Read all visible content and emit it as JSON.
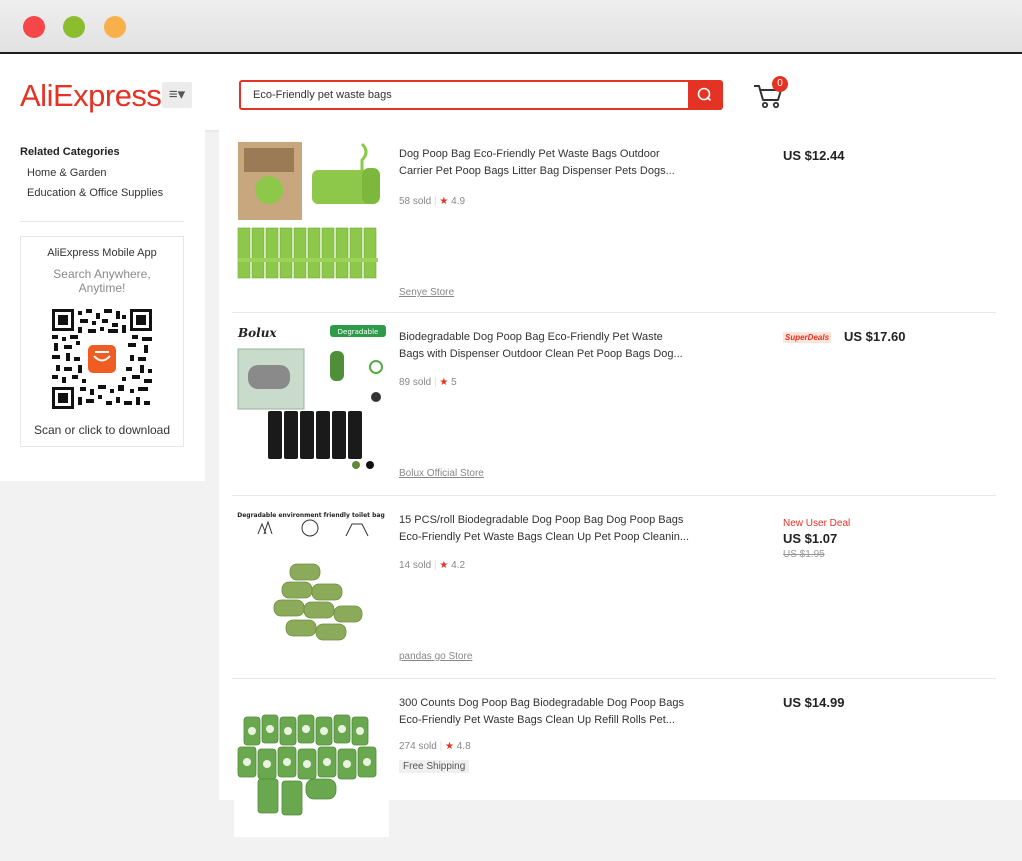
{
  "header": {
    "logo": "AliExpress",
    "category_icon": "menu-icon",
    "search_value": "Eco-Friendly pet waste bags",
    "cart_count": "0"
  },
  "sidebar": {
    "related_title": "Related Categories",
    "categories": [
      "Home & Garden",
      "Education & Office Supplies"
    ],
    "app_title": "AliExpress Mobile App",
    "app_subtitle": "Search Anywhere, Anytime!",
    "app_scan": "Scan or click to download"
  },
  "products": [
    {
      "title": "Dog Poop Bag Eco-Friendly Pet Waste Bags Outdoor Carrier Pet Poop Bags Litter Bag Dispenser Pets Dogs...",
      "sold": "58 sold",
      "rating": "4.9",
      "store": "Senye Store",
      "price": "US $12.44"
    },
    {
      "title": "Biodegradable Dog Poop Bag Eco-Friendly Pet Waste Bags with Dispenser Outdoor Clean Pet Poop Bags Dog...",
      "sold": "89 sold",
      "rating": "5",
      "store": "Bolux Official Store",
      "badge": "SuperDeals",
      "price": "US $17.60",
      "image_brand": "Bolux",
      "image_tag": "Degradable"
    },
    {
      "title": "15 PCS/roll Biodegradable Dog Poop Bag Dog Poop Bags Eco-Friendly Pet Waste Bags Clean Up Pet Poop Cleanin...",
      "sold": "14 sold",
      "rating": "4.2",
      "store": "pandas go Store",
      "deal": "New User Deal",
      "price": "US $1.07",
      "original_price": "US $1.95",
      "image_caption": "Degradable environment friendly toilet bag"
    },
    {
      "title": "300 Counts Dog Poop Bag Biodegradable Dog Poop Bags Eco-Friendly Pet Waste Bags Clean Up Refill Rolls Pet...",
      "sold": "274 sold",
      "rating": "4.8",
      "shipping": "Free Shipping",
      "price": "US $14.99"
    }
  ],
  "colors": {
    "brand": "#e43225",
    "bag_green": "#8dc84a"
  }
}
